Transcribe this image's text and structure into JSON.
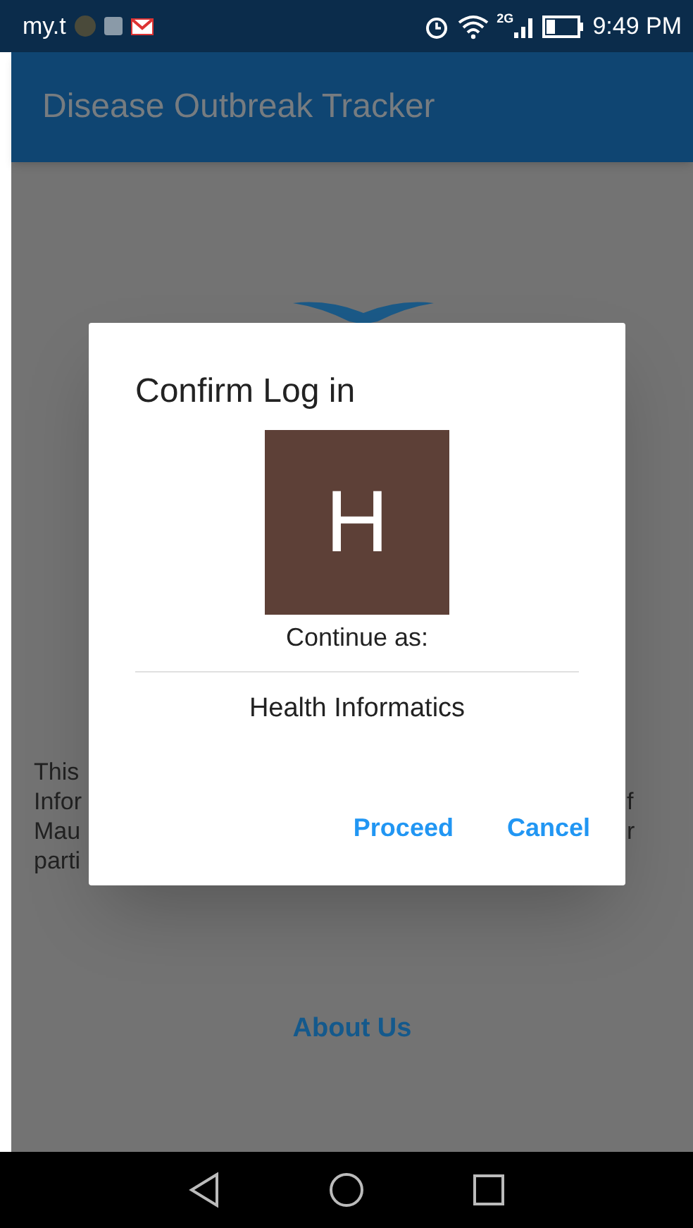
{
  "status_bar": {
    "carrier": "my.t",
    "network": "2G",
    "time": "9:49 PM"
  },
  "app_bar": {
    "title": "Disease Outbreak Tracker"
  },
  "background_text": {
    "left_lines": [
      "This",
      "Infor",
      "Mau",
      "parti"
    ],
    "right_lines": [
      "f",
      "r"
    ]
  },
  "about_link": "About Us",
  "dialog": {
    "title": "Confirm Log in",
    "avatar": {
      "letter": "H",
      "color": "#5d4037"
    },
    "prompt": "Continue as:",
    "account": "Health Informatics",
    "buttons": [
      "Proceed",
      "Cancel"
    ]
  }
}
